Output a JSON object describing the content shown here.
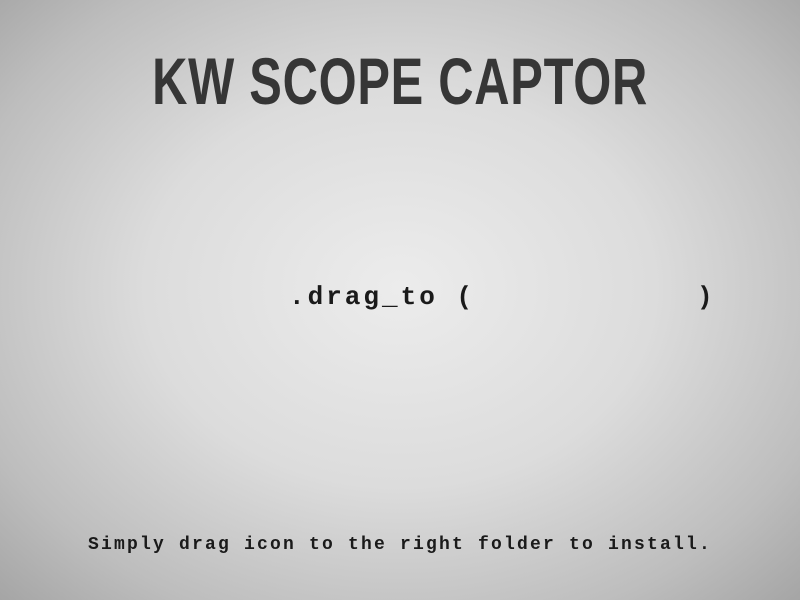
{
  "title": "KW SCOPE CAPTOR",
  "drag_label": ".drag_to (",
  "drag_close": ")",
  "hint": "Simply drag icon to the right folder to install."
}
